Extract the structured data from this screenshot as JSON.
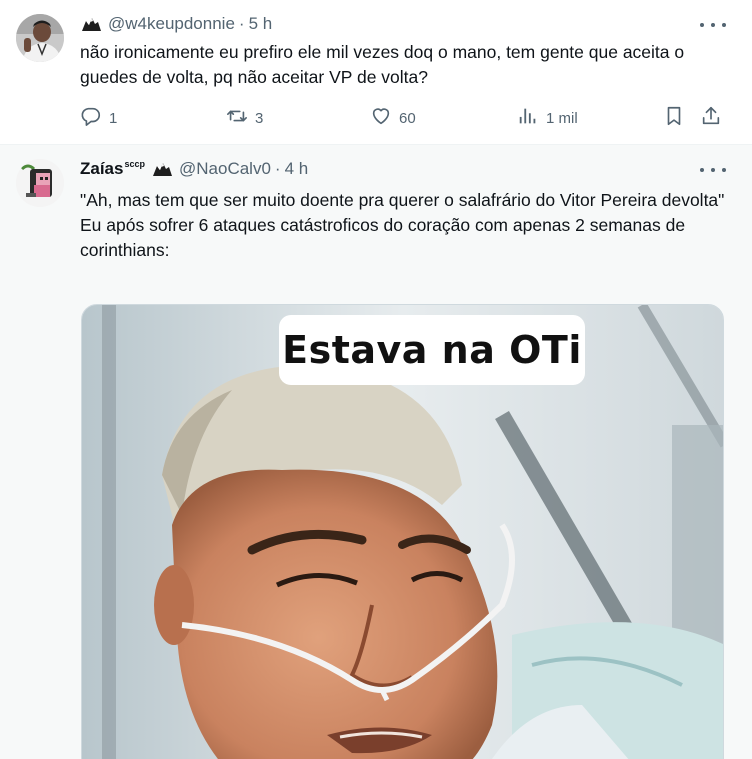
{
  "tweets": [
    {
      "display_name": "",
      "handle": "@w4keupdonnie",
      "time": "5 h",
      "text": "não ironicamente eu prefiro ele mil vezes doq o mano, tem gente que aceita o guedes de volta, pq não aceitar VP de volta?",
      "replies": "1",
      "retweets": "3",
      "likes": "60",
      "views": "1 mil"
    },
    {
      "display_name": "Zaías",
      "name_superscript": "sccp",
      "handle": "@NaoCalv0",
      "time": "4 h",
      "text_lines": [
        "\"Ah, mas tem que ser muito doente pra querer o salafrário do Vitor Pereira devolta\"",
        "Eu após sofrer 6 ataques catástroficos do coração com apenas 2 semanas de corinthians:"
      ],
      "media_caption": "Estava na OTi"
    }
  ],
  "icons": {
    "reply": "reply-icon",
    "retweet": "retweet-icon",
    "like": "heart-icon",
    "views": "views-chart-icon",
    "bookmark": "bookmark-icon",
    "share": "share-icon",
    "more": "more-icon",
    "badge": "bird-badge-icon"
  },
  "colors": {
    "text": "#0f1419",
    "secondary": "#536471",
    "background_hover": "#f7f9f9",
    "divider": "#eff3f4"
  }
}
